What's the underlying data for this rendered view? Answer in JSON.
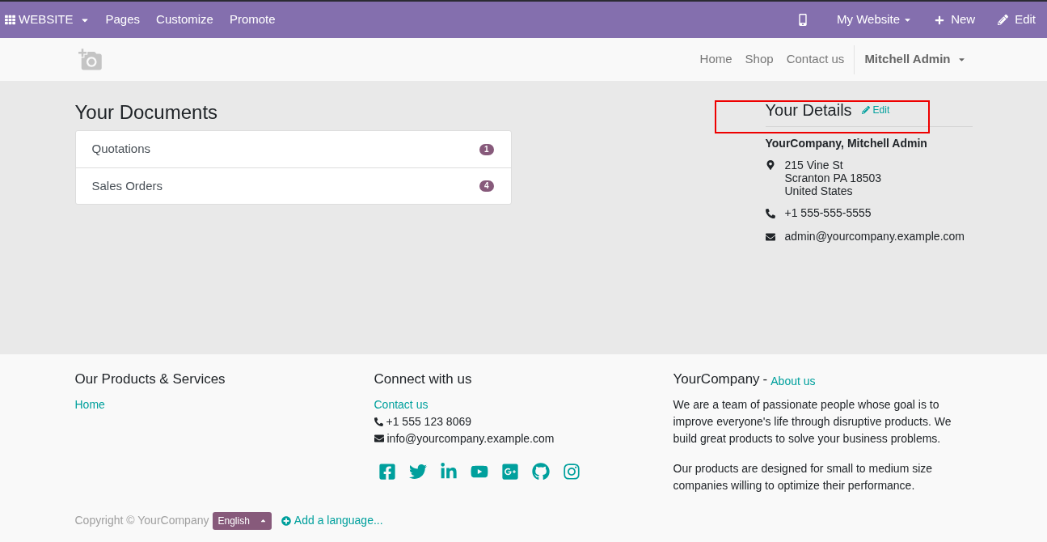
{
  "topbar": {
    "app_menu": "WEBSITE",
    "left_items": [
      "Pages",
      "Customize",
      "Promote"
    ],
    "site_menu": "My Website",
    "new_label": "New",
    "edit_label": "Edit"
  },
  "navbar": {
    "links": [
      "Home",
      "Shop",
      "Contact us"
    ],
    "user": "Mitchell Admin"
  },
  "documents": {
    "title": "Your Documents",
    "items": [
      {
        "label": "Quotations",
        "count": "1"
      },
      {
        "label": "Sales Orders",
        "count": "4"
      }
    ]
  },
  "details": {
    "title": "Your Details",
    "edit": "Edit",
    "name": "YourCompany, Mitchell Admin",
    "address": [
      "215 Vine St",
      "Scranton PA 18503",
      "United States"
    ],
    "phone": "+1 555-555-5555",
    "email": "admin@yourcompany.example.com"
  },
  "footer": {
    "products": {
      "title": "Our Products & Services",
      "links": [
        "Home"
      ]
    },
    "connect": {
      "title": "Connect with us",
      "link": "Contact us",
      "phone": "+1 555 123 8069",
      "email": "info@yourcompany.example.com"
    },
    "about": {
      "company": "YourCompany",
      "separator": "-",
      "link": "About us",
      "paragraphs": [
        "We are a team of passionate people whose goal is to improve everyone's life through disruptive products. We build great products to solve your business problems.",
        "Our products are designed for small to medium size companies willing to optimize their performance."
      ]
    },
    "copyright": "Copyright © YourCompany",
    "language": "English",
    "add_language": "Add a language..."
  }
}
